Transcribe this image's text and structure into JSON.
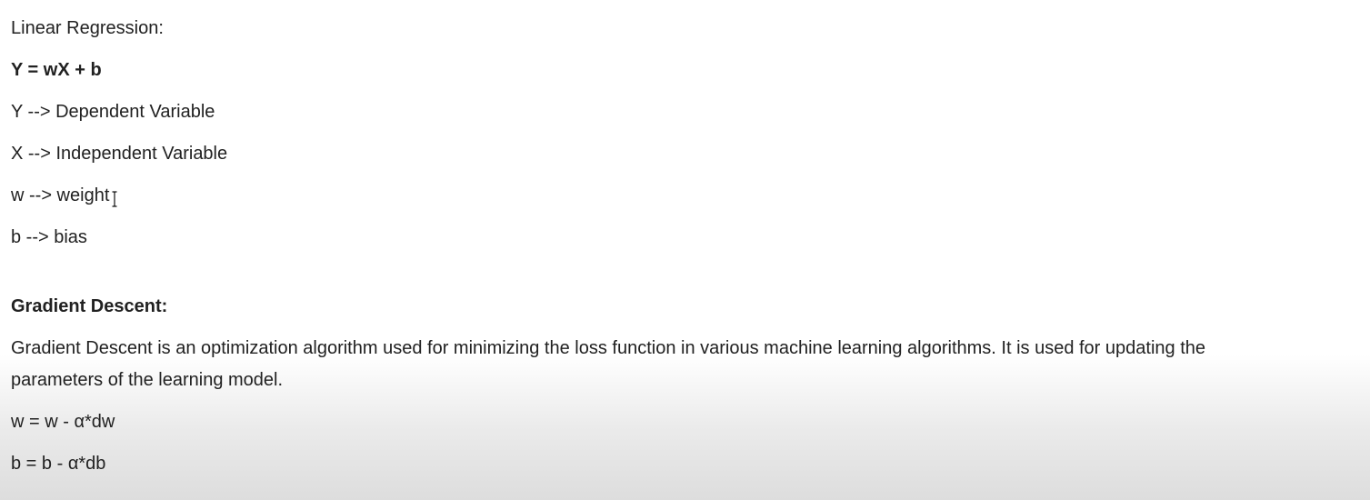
{
  "notebook": {
    "text_cell": {
      "heading_linear_regression": "Linear Regression:",
      "equation": "Y = wX + b",
      "def_y": "Y --> Dependent Variable",
      "def_x": "X --> Independent Variable",
      "def_w": "w --> weight",
      "def_b": "b --> bias",
      "heading_gradient_descent": "Gradient Descent:",
      "gd_description": "Gradient Descent is an optimization algorithm used for minimizing the loss function in various machine learning algorithms. It is used for updating the parameters of the learning model.",
      "update_w": "w = w - α*dw",
      "update_b": "b = b - α*db"
    }
  },
  "icons": {
    "cursor": "text-cursor-icon"
  },
  "colors": {
    "text": "#212121",
    "background_top": "#ffffff",
    "background_bottom": "#dddddd"
  }
}
